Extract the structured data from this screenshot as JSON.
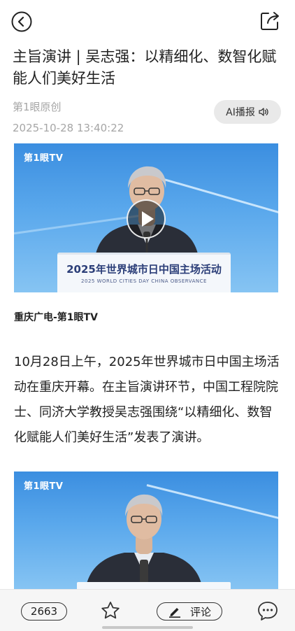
{
  "article": {
    "title": "主旨演讲 | 吴志强：以精细化、数智化赋能人们美好生活",
    "source": "第1眼原创",
    "datetime": "2025-10-28 13:40:22",
    "ai_button_label": "AI播报",
    "video": {
      "logo_text": "第1眼TV",
      "podium_title": "2025年世界城市日中国主场活动",
      "podium_subtitle": "2025 WORLD CITIES DAY CHINA OBSERVANCE"
    },
    "caption": "重庆广电-第1眼TV",
    "paragraph": "10月28日上午，2025年世界城市日中国主场活动在重庆开幕。在主旨演讲环节，中国工程院院士、同济大学教授吴志强围绕“以精细化、数智化赋能人们美好生活”发表了演讲。",
    "image2": {
      "logo_text": "第1眼TV"
    }
  },
  "bottom_bar": {
    "count": "2663",
    "comment_label": "评论"
  },
  "icons": {
    "back": "back-arrow-circle-icon",
    "share": "share-icon",
    "speaker": "speaker-icon",
    "play": "play-icon",
    "star": "star-icon",
    "pen": "pen-icon",
    "chat": "chat-bubble-icon"
  },
  "colors": {
    "video_blue": "#3b8ee0",
    "meta_gray": "#a6a6a6",
    "podium_text": "#2b3e78"
  }
}
